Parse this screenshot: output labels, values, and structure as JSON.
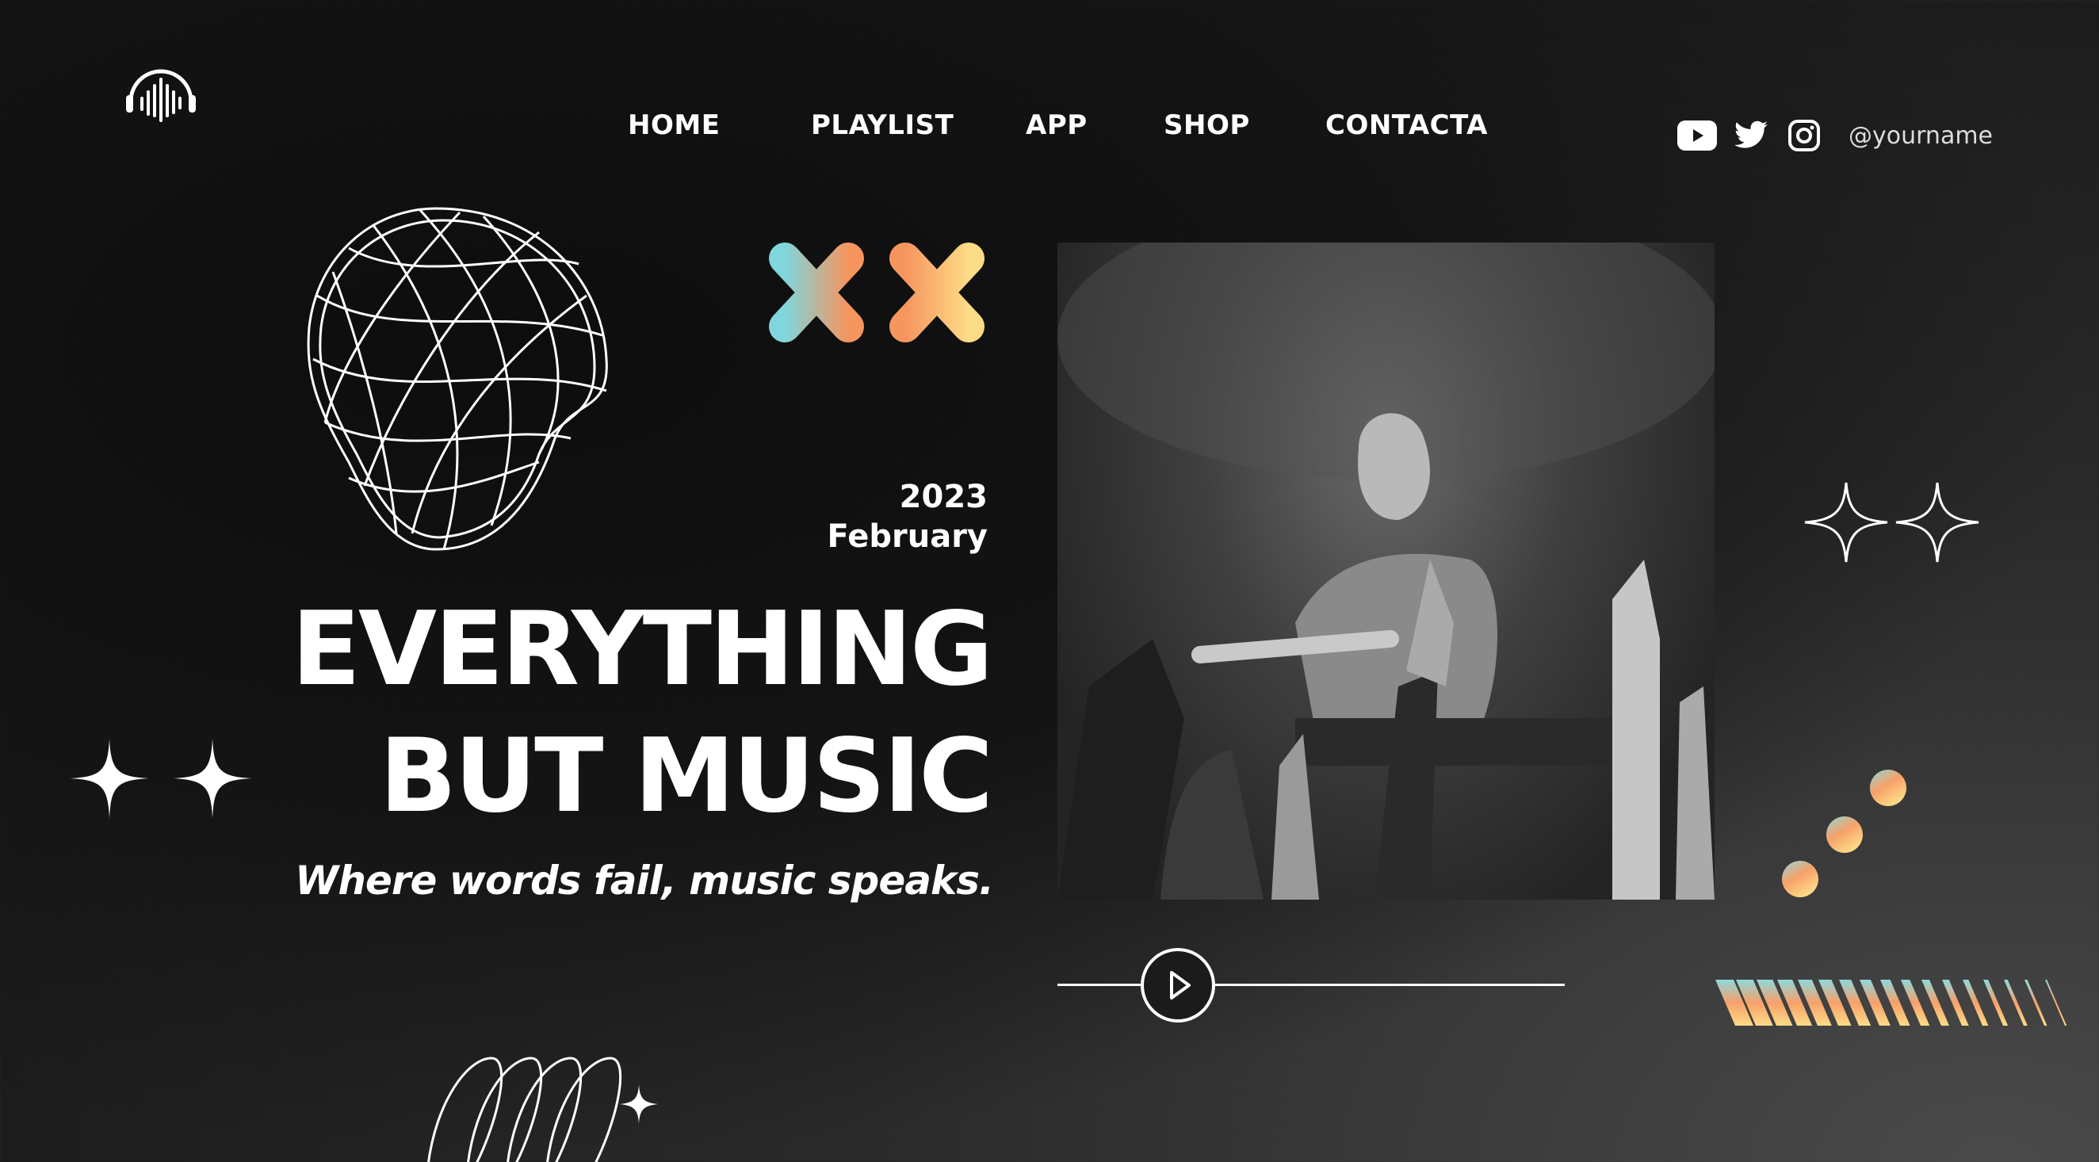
{
  "nav": {
    "items": [
      {
        "label": "HOME"
      },
      {
        "label": "PLAYLIST"
      },
      {
        "label": "APP"
      },
      {
        "label": "SHOP"
      },
      {
        "label": "CONTACTA"
      }
    ]
  },
  "social": {
    "icons": [
      "youtube-icon",
      "twitter-icon",
      "instagram-icon"
    ],
    "handle": "@yourname"
  },
  "hero": {
    "year": "2023",
    "month": "February",
    "headline_line1": "EVERYTHING",
    "headline_line2": "BUT MUSIC",
    "tagline": "Where words fail, music speaks."
  },
  "colors": {
    "gradient_teal": "#7fd6dc",
    "gradient_orange": "#f7955f",
    "gradient_yellow": "#fddc86",
    "background": "#141414"
  }
}
